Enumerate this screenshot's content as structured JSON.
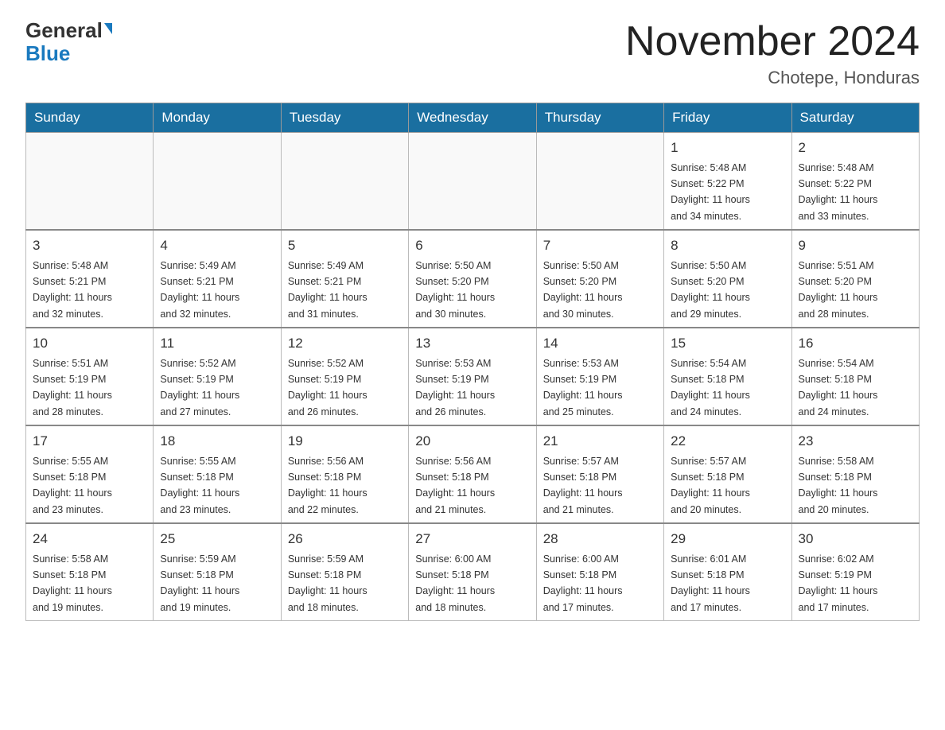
{
  "header": {
    "logo_general": "General",
    "logo_blue": "Blue",
    "title": "November 2024",
    "subtitle": "Chotepe, Honduras"
  },
  "weekdays": [
    "Sunday",
    "Monday",
    "Tuesday",
    "Wednesday",
    "Thursday",
    "Friday",
    "Saturday"
  ],
  "weeks": [
    [
      {
        "day": "",
        "info": ""
      },
      {
        "day": "",
        "info": ""
      },
      {
        "day": "",
        "info": ""
      },
      {
        "day": "",
        "info": ""
      },
      {
        "day": "",
        "info": ""
      },
      {
        "day": "1",
        "info": "Sunrise: 5:48 AM\nSunset: 5:22 PM\nDaylight: 11 hours\nand 34 minutes."
      },
      {
        "day": "2",
        "info": "Sunrise: 5:48 AM\nSunset: 5:22 PM\nDaylight: 11 hours\nand 33 minutes."
      }
    ],
    [
      {
        "day": "3",
        "info": "Sunrise: 5:48 AM\nSunset: 5:21 PM\nDaylight: 11 hours\nand 32 minutes."
      },
      {
        "day": "4",
        "info": "Sunrise: 5:49 AM\nSunset: 5:21 PM\nDaylight: 11 hours\nand 32 minutes."
      },
      {
        "day": "5",
        "info": "Sunrise: 5:49 AM\nSunset: 5:21 PM\nDaylight: 11 hours\nand 31 minutes."
      },
      {
        "day": "6",
        "info": "Sunrise: 5:50 AM\nSunset: 5:20 PM\nDaylight: 11 hours\nand 30 minutes."
      },
      {
        "day": "7",
        "info": "Sunrise: 5:50 AM\nSunset: 5:20 PM\nDaylight: 11 hours\nand 30 minutes."
      },
      {
        "day": "8",
        "info": "Sunrise: 5:50 AM\nSunset: 5:20 PM\nDaylight: 11 hours\nand 29 minutes."
      },
      {
        "day": "9",
        "info": "Sunrise: 5:51 AM\nSunset: 5:20 PM\nDaylight: 11 hours\nand 28 minutes."
      }
    ],
    [
      {
        "day": "10",
        "info": "Sunrise: 5:51 AM\nSunset: 5:19 PM\nDaylight: 11 hours\nand 28 minutes."
      },
      {
        "day": "11",
        "info": "Sunrise: 5:52 AM\nSunset: 5:19 PM\nDaylight: 11 hours\nand 27 minutes."
      },
      {
        "day": "12",
        "info": "Sunrise: 5:52 AM\nSunset: 5:19 PM\nDaylight: 11 hours\nand 26 minutes."
      },
      {
        "day": "13",
        "info": "Sunrise: 5:53 AM\nSunset: 5:19 PM\nDaylight: 11 hours\nand 26 minutes."
      },
      {
        "day": "14",
        "info": "Sunrise: 5:53 AM\nSunset: 5:19 PM\nDaylight: 11 hours\nand 25 minutes."
      },
      {
        "day": "15",
        "info": "Sunrise: 5:54 AM\nSunset: 5:18 PM\nDaylight: 11 hours\nand 24 minutes."
      },
      {
        "day": "16",
        "info": "Sunrise: 5:54 AM\nSunset: 5:18 PM\nDaylight: 11 hours\nand 24 minutes."
      }
    ],
    [
      {
        "day": "17",
        "info": "Sunrise: 5:55 AM\nSunset: 5:18 PM\nDaylight: 11 hours\nand 23 minutes."
      },
      {
        "day": "18",
        "info": "Sunrise: 5:55 AM\nSunset: 5:18 PM\nDaylight: 11 hours\nand 23 minutes."
      },
      {
        "day": "19",
        "info": "Sunrise: 5:56 AM\nSunset: 5:18 PM\nDaylight: 11 hours\nand 22 minutes."
      },
      {
        "day": "20",
        "info": "Sunrise: 5:56 AM\nSunset: 5:18 PM\nDaylight: 11 hours\nand 21 minutes."
      },
      {
        "day": "21",
        "info": "Sunrise: 5:57 AM\nSunset: 5:18 PM\nDaylight: 11 hours\nand 21 minutes."
      },
      {
        "day": "22",
        "info": "Sunrise: 5:57 AM\nSunset: 5:18 PM\nDaylight: 11 hours\nand 20 minutes."
      },
      {
        "day": "23",
        "info": "Sunrise: 5:58 AM\nSunset: 5:18 PM\nDaylight: 11 hours\nand 20 minutes."
      }
    ],
    [
      {
        "day": "24",
        "info": "Sunrise: 5:58 AM\nSunset: 5:18 PM\nDaylight: 11 hours\nand 19 minutes."
      },
      {
        "day": "25",
        "info": "Sunrise: 5:59 AM\nSunset: 5:18 PM\nDaylight: 11 hours\nand 19 minutes."
      },
      {
        "day": "26",
        "info": "Sunrise: 5:59 AM\nSunset: 5:18 PM\nDaylight: 11 hours\nand 18 minutes."
      },
      {
        "day": "27",
        "info": "Sunrise: 6:00 AM\nSunset: 5:18 PM\nDaylight: 11 hours\nand 18 minutes."
      },
      {
        "day": "28",
        "info": "Sunrise: 6:00 AM\nSunset: 5:18 PM\nDaylight: 11 hours\nand 17 minutes."
      },
      {
        "day": "29",
        "info": "Sunrise: 6:01 AM\nSunset: 5:18 PM\nDaylight: 11 hours\nand 17 minutes."
      },
      {
        "day": "30",
        "info": "Sunrise: 6:02 AM\nSunset: 5:19 PM\nDaylight: 11 hours\nand 17 minutes."
      }
    ]
  ]
}
